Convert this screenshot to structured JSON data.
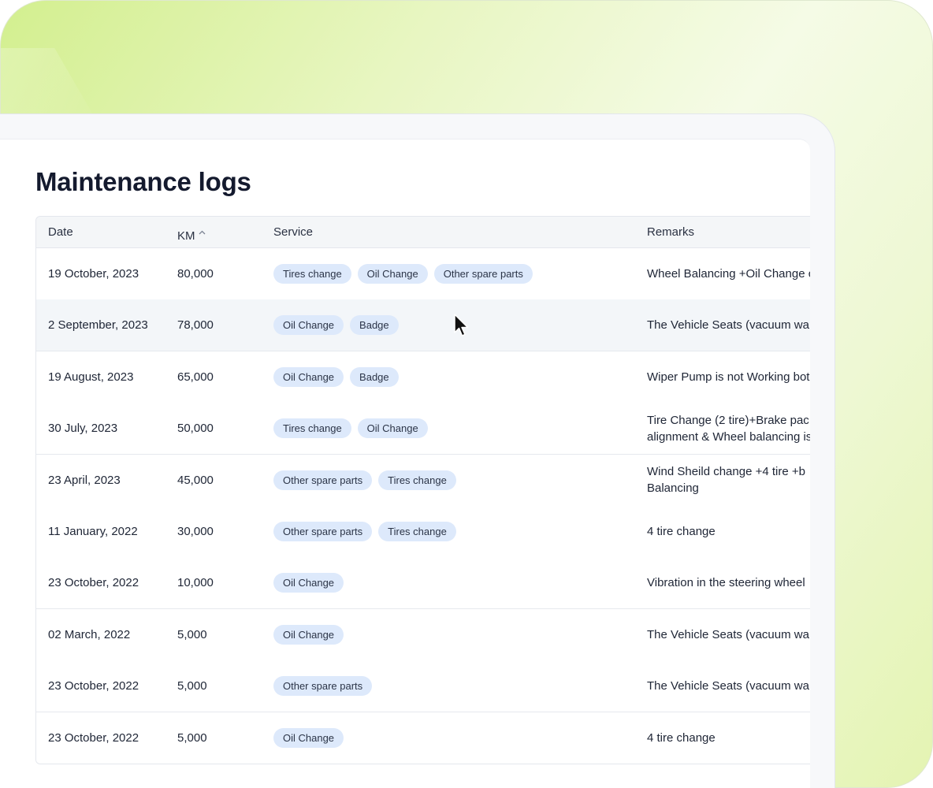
{
  "page": {
    "title": "Maintenance logs"
  },
  "table": {
    "columns": {
      "date": "Date",
      "km": "KM",
      "service": "Service",
      "remarks": "Remarks"
    },
    "sort_column": "KM",
    "sort_icon": "chevron-up-icon",
    "hovered_row_index": 1,
    "rows": [
      {
        "date": "19 October, 2023",
        "km": "80,000",
        "services": [
          "Tires change",
          "Oil Change",
          "Other spare parts"
        ],
        "remarks": [
          "Wheel Balancing +Oil Change c"
        ]
      },
      {
        "date": "2 September, 2023",
        "km": "78,000",
        "services": [
          "Oil Change",
          "Badge"
        ],
        "remarks": [
          "The Vehicle Seats (vacuum wa"
        ]
      },
      {
        "date": "19 August, 2023",
        "km": "65,000",
        "services": [
          "Oil Change",
          "Badge"
        ],
        "remarks": [
          "Wiper Pump is not Working bot"
        ]
      },
      {
        "date": "30 July, 2023",
        "km": "50,000",
        "services": [
          "Tires change",
          "Oil Change"
        ],
        "remarks": [
          "Tire Change (2 tire)+Brake pac",
          "alignment & Wheel balancing is"
        ]
      },
      {
        "date": "23 April, 2023",
        "km": "45,000",
        "services": [
          "Other spare parts",
          "Tires change"
        ],
        "remarks": [
          "Wind Sheild change +4 tire +b",
          "Balancing"
        ]
      },
      {
        "date": "11 January, 2022",
        "km": "30,000",
        "services": [
          "Other spare parts",
          "Tires change"
        ],
        "remarks": [
          "4 tire change"
        ]
      },
      {
        "date": "23 October, 2022",
        "km": "10,000",
        "services": [
          "Oil Change"
        ],
        "remarks": [
          "Vibration in the steering wheel"
        ]
      },
      {
        "date": "02 March, 2022",
        "km": "5,000",
        "services": [
          "Oil Change"
        ],
        "remarks": [
          "The Vehicle Seats (vacuum wa"
        ]
      },
      {
        "date": "23 October, 2022",
        "km": "5,000",
        "services": [
          "Other spare parts"
        ],
        "remarks": [
          "The Vehicle Seats (vacuum wa"
        ]
      },
      {
        "date": "23 October, 2022",
        "km": "5,000",
        "services": [
          "Oil Change"
        ],
        "remarks": [
          "4 tire change"
        ]
      }
    ]
  },
  "colors": {
    "tag_bg": "#dde9fb",
    "title": "#141a2e",
    "header_bg": "#f4f6f8",
    "hover_row_bg": "#f3f6f9"
  }
}
